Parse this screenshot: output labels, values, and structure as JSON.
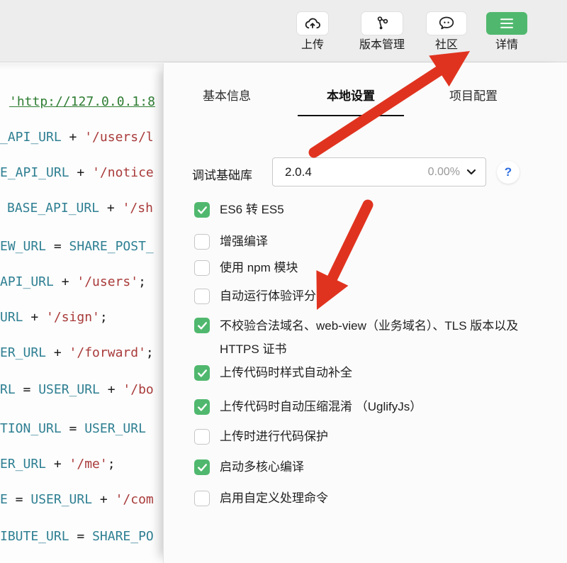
{
  "toolbar": {
    "items": [
      {
        "name": "upload",
        "label": "上传",
        "icon": "upload-cloud-icon",
        "style": "default"
      },
      {
        "name": "version-control",
        "label": "版本管理",
        "icon": "version-branch-icon",
        "style": "default"
      },
      {
        "name": "community",
        "label": "社区",
        "icon": "community-chat-icon",
        "style": "default"
      },
      {
        "name": "details",
        "label": "详情",
        "icon": "details-menu-icon",
        "style": "primary"
      }
    ]
  },
  "editor": {
    "lines": [
      {
        "segments": [
          {
            "text": "'http://127.0.0.1:8",
            "type": "link"
          }
        ]
      },
      {
        "segments": [
          {
            "text": "_API_URL",
            "type": "var"
          },
          {
            "text": " + ",
            "type": "op"
          },
          {
            "text": "'/users/l",
            "type": "str"
          }
        ]
      },
      {
        "segments": [
          {
            "text": "E_API_URL",
            "type": "var"
          },
          {
            "text": " + ",
            "type": "op"
          },
          {
            "text": "'/notice",
            "type": "str"
          }
        ]
      },
      {
        "segments": [
          {
            "text": "BASE_API_URL",
            "type": "var"
          },
          {
            "text": " + ",
            "type": "op"
          },
          {
            "text": "'/sh",
            "type": "str"
          }
        ]
      },
      {
        "segments": [
          {
            "text": "EW_URL",
            "type": "var"
          },
          {
            "text": " = ",
            "type": "op"
          },
          {
            "text": "SHARE_POST_",
            "type": "var"
          }
        ]
      },
      {
        "segments": [
          {
            "text": "API_URL",
            "type": "var"
          },
          {
            "text": " + ",
            "type": "op"
          },
          {
            "text": "'/users'",
            "type": "str"
          },
          {
            "text": ";",
            "type": "op"
          }
        ]
      },
      {
        "segments": [
          {
            "text": "URL",
            "type": "var"
          },
          {
            "text": " + ",
            "type": "op"
          },
          {
            "text": "'/sign'",
            "type": "str"
          },
          {
            "text": ";",
            "type": "op"
          }
        ]
      },
      {
        "segments": [
          {
            "text": "ER_URL",
            "type": "var"
          },
          {
            "text": " + ",
            "type": "op"
          },
          {
            "text": "'/forward'",
            "type": "str"
          },
          {
            "text": ";",
            "type": "op"
          }
        ]
      },
      {
        "segments": [
          {
            "text": "RL",
            "type": "var"
          },
          {
            "text": " = ",
            "type": "op"
          },
          {
            "text": "USER_URL",
            "type": "var"
          },
          {
            "text": " + ",
            "type": "op"
          },
          {
            "text": "'/bo",
            "type": "str"
          }
        ]
      },
      {
        "segments": [
          {
            "text": "TION_URL",
            "type": "var"
          },
          {
            "text": " = ",
            "type": "op"
          },
          {
            "text": "USER_URL",
            "type": "var"
          }
        ]
      },
      {
        "segments": [
          {
            "text": "ER_URL",
            "type": "var"
          },
          {
            "text": " + ",
            "type": "op"
          },
          {
            "text": "'/me'",
            "type": "str"
          },
          {
            "text": ";",
            "type": "op"
          }
        ]
      },
      {
        "segments": [
          {
            "text": "E",
            "type": "var"
          },
          {
            "text": " = ",
            "type": "op"
          },
          {
            "text": "USER_URL",
            "type": "var"
          },
          {
            "text": " + ",
            "type": "op"
          },
          {
            "text": "'/com",
            "type": "str"
          }
        ]
      },
      {
        "segments": [
          {
            "text": "IBUTE_URL",
            "type": "var"
          },
          {
            "text": " = ",
            "type": "op"
          },
          {
            "text": "SHARE_PO",
            "type": "var"
          }
        ]
      }
    ]
  },
  "panel": {
    "tabs": [
      {
        "name": "basic-info",
        "label": "基本信息",
        "active": false
      },
      {
        "name": "local-settings",
        "label": "本地设置",
        "active": true
      },
      {
        "name": "project-config",
        "label": "项目配置",
        "active": false
      }
    ],
    "base_library": {
      "label": "调试基础库",
      "version": "2.0.4",
      "usage": "0.00%",
      "help_glyph": "?"
    },
    "checkboxes": [
      {
        "name": "es6-to-es5",
        "label": "ES6 转 ES5",
        "checked": true
      },
      {
        "name": "enhanced-compile",
        "label": "增强编译",
        "checked": false
      },
      {
        "name": "npm-module",
        "label": "使用 npm 模块",
        "checked": false
      },
      {
        "name": "auto-audit",
        "label": "自动运行体验评分",
        "checked": false
      },
      {
        "name": "skip-domain-check",
        "label": "不校验合法域名、web-view（业务域名）、TLS 版本以及 HTTPS 证书",
        "checked": true,
        "wide": true
      },
      {
        "name": "style-autocomplete",
        "label": "上传代码时样式自动补全",
        "checked": true
      },
      {
        "name": "auto-uglify",
        "label": "上传代码时自动压缩混淆 （UglifyJs）",
        "checked": true
      },
      {
        "name": "code-protect",
        "label": "上传时进行代码保护",
        "checked": false
      },
      {
        "name": "multicore-compile",
        "label": "启动多核心编译",
        "checked": true
      },
      {
        "name": "custom-command",
        "label": "启用自定义处理命令",
        "checked": false
      }
    ]
  },
  "colors": {
    "accent_green": "#50b86e",
    "arrow_red": "#e0331f",
    "code_variable": "#2e7f92",
    "code_string": "#a93a3a",
    "code_link": "#2e7d32",
    "help_blue": "#2b6de0"
  }
}
